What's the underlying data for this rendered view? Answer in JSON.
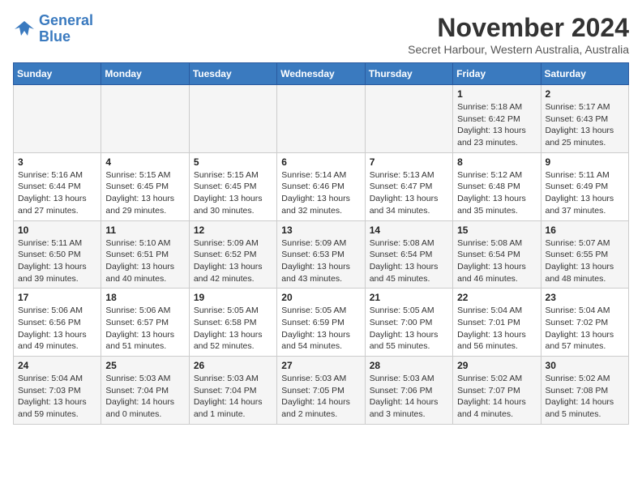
{
  "logo": {
    "line1": "General",
    "line2": "Blue"
  },
  "title": "November 2024",
  "subtitle": "Secret Harbour, Western Australia, Australia",
  "weekdays": [
    "Sunday",
    "Monday",
    "Tuesday",
    "Wednesday",
    "Thursday",
    "Friday",
    "Saturday"
  ],
  "weeks": [
    [
      {
        "day": "",
        "info": ""
      },
      {
        "day": "",
        "info": ""
      },
      {
        "day": "",
        "info": ""
      },
      {
        "day": "",
        "info": ""
      },
      {
        "day": "",
        "info": ""
      },
      {
        "day": "1",
        "info": "Sunrise: 5:18 AM\nSunset: 6:42 PM\nDaylight: 13 hours\nand 23 minutes."
      },
      {
        "day": "2",
        "info": "Sunrise: 5:17 AM\nSunset: 6:43 PM\nDaylight: 13 hours\nand 25 minutes."
      }
    ],
    [
      {
        "day": "3",
        "info": "Sunrise: 5:16 AM\nSunset: 6:44 PM\nDaylight: 13 hours\nand 27 minutes."
      },
      {
        "day": "4",
        "info": "Sunrise: 5:15 AM\nSunset: 6:45 PM\nDaylight: 13 hours\nand 29 minutes."
      },
      {
        "day": "5",
        "info": "Sunrise: 5:15 AM\nSunset: 6:45 PM\nDaylight: 13 hours\nand 30 minutes."
      },
      {
        "day": "6",
        "info": "Sunrise: 5:14 AM\nSunset: 6:46 PM\nDaylight: 13 hours\nand 32 minutes."
      },
      {
        "day": "7",
        "info": "Sunrise: 5:13 AM\nSunset: 6:47 PM\nDaylight: 13 hours\nand 34 minutes."
      },
      {
        "day": "8",
        "info": "Sunrise: 5:12 AM\nSunset: 6:48 PM\nDaylight: 13 hours\nand 35 minutes."
      },
      {
        "day": "9",
        "info": "Sunrise: 5:11 AM\nSunset: 6:49 PM\nDaylight: 13 hours\nand 37 minutes."
      }
    ],
    [
      {
        "day": "10",
        "info": "Sunrise: 5:11 AM\nSunset: 6:50 PM\nDaylight: 13 hours\nand 39 minutes."
      },
      {
        "day": "11",
        "info": "Sunrise: 5:10 AM\nSunset: 6:51 PM\nDaylight: 13 hours\nand 40 minutes."
      },
      {
        "day": "12",
        "info": "Sunrise: 5:09 AM\nSunset: 6:52 PM\nDaylight: 13 hours\nand 42 minutes."
      },
      {
        "day": "13",
        "info": "Sunrise: 5:09 AM\nSunset: 6:53 PM\nDaylight: 13 hours\nand 43 minutes."
      },
      {
        "day": "14",
        "info": "Sunrise: 5:08 AM\nSunset: 6:54 PM\nDaylight: 13 hours\nand 45 minutes."
      },
      {
        "day": "15",
        "info": "Sunrise: 5:08 AM\nSunset: 6:54 PM\nDaylight: 13 hours\nand 46 minutes."
      },
      {
        "day": "16",
        "info": "Sunrise: 5:07 AM\nSunset: 6:55 PM\nDaylight: 13 hours\nand 48 minutes."
      }
    ],
    [
      {
        "day": "17",
        "info": "Sunrise: 5:06 AM\nSunset: 6:56 PM\nDaylight: 13 hours\nand 49 minutes."
      },
      {
        "day": "18",
        "info": "Sunrise: 5:06 AM\nSunset: 6:57 PM\nDaylight: 13 hours\nand 51 minutes."
      },
      {
        "day": "19",
        "info": "Sunrise: 5:05 AM\nSunset: 6:58 PM\nDaylight: 13 hours\nand 52 minutes."
      },
      {
        "day": "20",
        "info": "Sunrise: 5:05 AM\nSunset: 6:59 PM\nDaylight: 13 hours\nand 54 minutes."
      },
      {
        "day": "21",
        "info": "Sunrise: 5:05 AM\nSunset: 7:00 PM\nDaylight: 13 hours\nand 55 minutes."
      },
      {
        "day": "22",
        "info": "Sunrise: 5:04 AM\nSunset: 7:01 PM\nDaylight: 13 hours\nand 56 minutes."
      },
      {
        "day": "23",
        "info": "Sunrise: 5:04 AM\nSunset: 7:02 PM\nDaylight: 13 hours\nand 57 minutes."
      }
    ],
    [
      {
        "day": "24",
        "info": "Sunrise: 5:04 AM\nSunset: 7:03 PM\nDaylight: 13 hours\nand 59 minutes."
      },
      {
        "day": "25",
        "info": "Sunrise: 5:03 AM\nSunset: 7:04 PM\nDaylight: 14 hours\nand 0 minutes."
      },
      {
        "day": "26",
        "info": "Sunrise: 5:03 AM\nSunset: 7:04 PM\nDaylight: 14 hours\nand 1 minute."
      },
      {
        "day": "27",
        "info": "Sunrise: 5:03 AM\nSunset: 7:05 PM\nDaylight: 14 hours\nand 2 minutes."
      },
      {
        "day": "28",
        "info": "Sunrise: 5:03 AM\nSunset: 7:06 PM\nDaylight: 14 hours\nand 3 minutes."
      },
      {
        "day": "29",
        "info": "Sunrise: 5:02 AM\nSunset: 7:07 PM\nDaylight: 14 hours\nand 4 minutes."
      },
      {
        "day": "30",
        "info": "Sunrise: 5:02 AM\nSunset: 7:08 PM\nDaylight: 14 hours\nand 5 minutes."
      }
    ]
  ]
}
